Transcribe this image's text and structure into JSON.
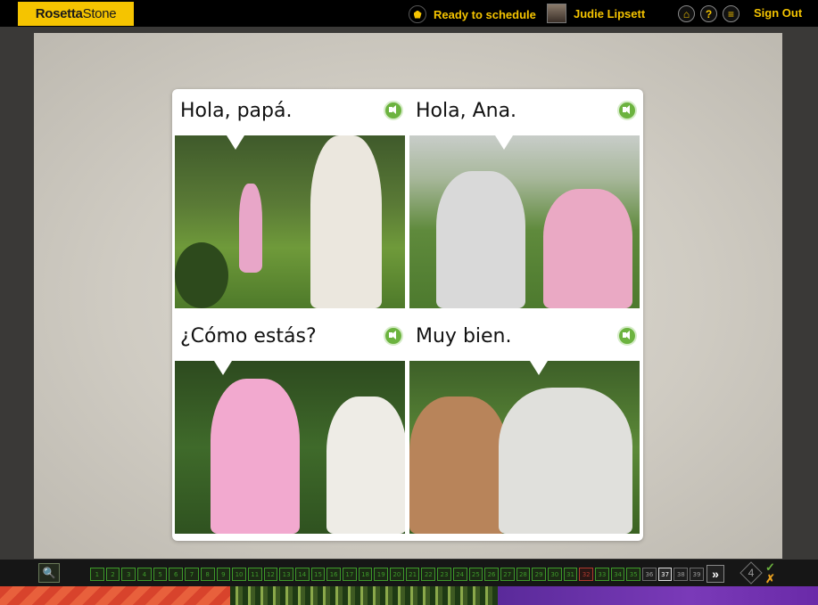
{
  "app": {
    "logo_text_bold": "Rosetta",
    "logo_text_light": "Stone"
  },
  "header": {
    "status": "Ready to schedule",
    "user_name": "Judie Lipsett",
    "sign_out": "Sign Out",
    "icons": [
      "home-icon",
      "help-icon",
      "menu-icon"
    ]
  },
  "lesson": {
    "cells": [
      {
        "caption": "Hola, papá."
      },
      {
        "caption": "Hola, Ana."
      },
      {
        "caption": "¿Cómo estás?"
      },
      {
        "caption": "Muy bien."
      }
    ]
  },
  "progress": {
    "screens": [
      "1",
      "2",
      "3",
      "4",
      "5",
      "6",
      "7",
      "8",
      "9",
      "10",
      "11",
      "12",
      "13",
      "14",
      "15",
      "16",
      "17",
      "18",
      "19",
      "20",
      "21",
      "22",
      "23",
      "24",
      "25",
      "26",
      "27",
      "28",
      "29",
      "30",
      "31",
      "32",
      "33",
      "34",
      "35",
      "36",
      "37",
      "38",
      "39"
    ],
    "current_screen": "37",
    "score_diamond": "4"
  },
  "colors": {
    "brand_yellow": "#f5c400",
    "correct_green": "#3e9a2a",
    "wrong_red": "#b03a2e"
  }
}
